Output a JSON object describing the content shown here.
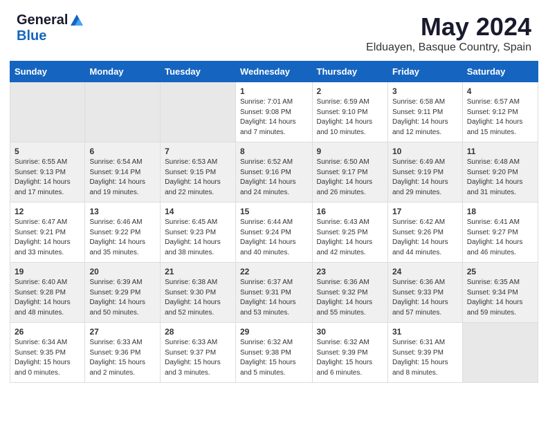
{
  "header": {
    "logo_general": "General",
    "logo_blue": "Blue",
    "title": "May 2024",
    "subtitle": "Elduayen, Basque Country, Spain"
  },
  "days_of_week": [
    "Sunday",
    "Monday",
    "Tuesday",
    "Wednesday",
    "Thursday",
    "Friday",
    "Saturday"
  ],
  "weeks": [
    [
      {
        "day": "",
        "info": ""
      },
      {
        "day": "",
        "info": ""
      },
      {
        "day": "",
        "info": ""
      },
      {
        "day": "1",
        "info": "Sunrise: 7:01 AM\nSunset: 9:08 PM\nDaylight: 14 hours\nand 7 minutes."
      },
      {
        "day": "2",
        "info": "Sunrise: 6:59 AM\nSunset: 9:10 PM\nDaylight: 14 hours\nand 10 minutes."
      },
      {
        "day": "3",
        "info": "Sunrise: 6:58 AM\nSunset: 9:11 PM\nDaylight: 14 hours\nand 12 minutes."
      },
      {
        "day": "4",
        "info": "Sunrise: 6:57 AM\nSunset: 9:12 PM\nDaylight: 14 hours\nand 15 minutes."
      }
    ],
    [
      {
        "day": "5",
        "info": "Sunrise: 6:55 AM\nSunset: 9:13 PM\nDaylight: 14 hours\nand 17 minutes."
      },
      {
        "day": "6",
        "info": "Sunrise: 6:54 AM\nSunset: 9:14 PM\nDaylight: 14 hours\nand 19 minutes."
      },
      {
        "day": "7",
        "info": "Sunrise: 6:53 AM\nSunset: 9:15 PM\nDaylight: 14 hours\nand 22 minutes."
      },
      {
        "day": "8",
        "info": "Sunrise: 6:52 AM\nSunset: 9:16 PM\nDaylight: 14 hours\nand 24 minutes."
      },
      {
        "day": "9",
        "info": "Sunrise: 6:50 AM\nSunset: 9:17 PM\nDaylight: 14 hours\nand 26 minutes."
      },
      {
        "day": "10",
        "info": "Sunrise: 6:49 AM\nSunset: 9:19 PM\nDaylight: 14 hours\nand 29 minutes."
      },
      {
        "day": "11",
        "info": "Sunrise: 6:48 AM\nSunset: 9:20 PM\nDaylight: 14 hours\nand 31 minutes."
      }
    ],
    [
      {
        "day": "12",
        "info": "Sunrise: 6:47 AM\nSunset: 9:21 PM\nDaylight: 14 hours\nand 33 minutes."
      },
      {
        "day": "13",
        "info": "Sunrise: 6:46 AM\nSunset: 9:22 PM\nDaylight: 14 hours\nand 35 minutes."
      },
      {
        "day": "14",
        "info": "Sunrise: 6:45 AM\nSunset: 9:23 PM\nDaylight: 14 hours\nand 38 minutes."
      },
      {
        "day": "15",
        "info": "Sunrise: 6:44 AM\nSunset: 9:24 PM\nDaylight: 14 hours\nand 40 minutes."
      },
      {
        "day": "16",
        "info": "Sunrise: 6:43 AM\nSunset: 9:25 PM\nDaylight: 14 hours\nand 42 minutes."
      },
      {
        "day": "17",
        "info": "Sunrise: 6:42 AM\nSunset: 9:26 PM\nDaylight: 14 hours\nand 44 minutes."
      },
      {
        "day": "18",
        "info": "Sunrise: 6:41 AM\nSunset: 9:27 PM\nDaylight: 14 hours\nand 46 minutes."
      }
    ],
    [
      {
        "day": "19",
        "info": "Sunrise: 6:40 AM\nSunset: 9:28 PM\nDaylight: 14 hours\nand 48 minutes."
      },
      {
        "day": "20",
        "info": "Sunrise: 6:39 AM\nSunset: 9:29 PM\nDaylight: 14 hours\nand 50 minutes."
      },
      {
        "day": "21",
        "info": "Sunrise: 6:38 AM\nSunset: 9:30 PM\nDaylight: 14 hours\nand 52 minutes."
      },
      {
        "day": "22",
        "info": "Sunrise: 6:37 AM\nSunset: 9:31 PM\nDaylight: 14 hours\nand 53 minutes."
      },
      {
        "day": "23",
        "info": "Sunrise: 6:36 AM\nSunset: 9:32 PM\nDaylight: 14 hours\nand 55 minutes."
      },
      {
        "day": "24",
        "info": "Sunrise: 6:36 AM\nSunset: 9:33 PM\nDaylight: 14 hours\nand 57 minutes."
      },
      {
        "day": "25",
        "info": "Sunrise: 6:35 AM\nSunset: 9:34 PM\nDaylight: 14 hours\nand 59 minutes."
      }
    ],
    [
      {
        "day": "26",
        "info": "Sunrise: 6:34 AM\nSunset: 9:35 PM\nDaylight: 15 hours\nand 0 minutes."
      },
      {
        "day": "27",
        "info": "Sunrise: 6:33 AM\nSunset: 9:36 PM\nDaylight: 15 hours\nand 2 minutes."
      },
      {
        "day": "28",
        "info": "Sunrise: 6:33 AM\nSunset: 9:37 PM\nDaylight: 15 hours\nand 3 minutes."
      },
      {
        "day": "29",
        "info": "Sunrise: 6:32 AM\nSunset: 9:38 PM\nDaylight: 15 hours\nand 5 minutes."
      },
      {
        "day": "30",
        "info": "Sunrise: 6:32 AM\nSunset: 9:39 PM\nDaylight: 15 hours\nand 6 minutes."
      },
      {
        "day": "31",
        "info": "Sunrise: 6:31 AM\nSunset: 9:39 PM\nDaylight: 15 hours\nand 8 minutes."
      },
      {
        "day": "",
        "info": ""
      }
    ]
  ]
}
